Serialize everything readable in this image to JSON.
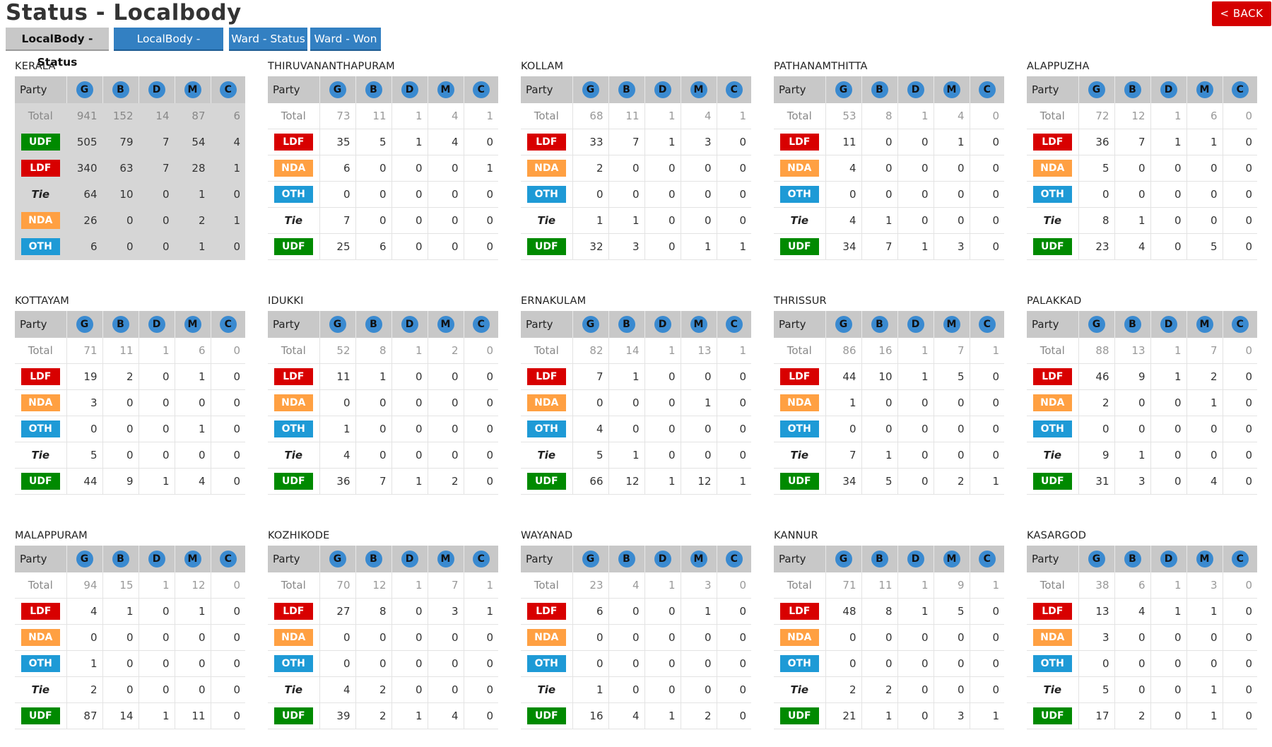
{
  "page_title": "Status - Localbody",
  "back_label": "< BACK",
  "tabs": [
    {
      "label": "LocalBody - Status",
      "active": true
    },
    {
      "label": "LocalBody - Majority",
      "active": false
    },
    {
      "label": "Ward - Status",
      "active": false
    },
    {
      "label": "Ward - Won",
      "active": false
    }
  ],
  "columns": [
    "Party",
    "G",
    "B",
    "D",
    "M",
    "C"
  ],
  "colors": {
    "UDF": "#008a00",
    "LDF": "#d80000",
    "NDA": "#ffa042",
    "OTH": "#1e9ad6",
    "header_circle": "#3a8ad0",
    "tab": "#3380c2",
    "back": "#d50000"
  },
  "districts": [
    {
      "name": "KERALA",
      "rows": [
        {
          "party": "Total",
          "v": [
            941,
            152,
            14,
            87,
            6
          ]
        },
        {
          "party": "UDF",
          "v": [
            505,
            79,
            7,
            54,
            4
          ]
        },
        {
          "party": "LDF",
          "v": [
            340,
            63,
            7,
            28,
            1
          ]
        },
        {
          "party": "Tie",
          "v": [
            64,
            10,
            0,
            1,
            0
          ]
        },
        {
          "party": "NDA",
          "v": [
            26,
            0,
            0,
            2,
            1
          ]
        },
        {
          "party": "OTH",
          "v": [
            6,
            0,
            0,
            1,
            0
          ]
        }
      ]
    },
    {
      "name": "THIRUVANANTHAPURAM",
      "rows": [
        {
          "party": "Total",
          "v": [
            73,
            11,
            1,
            4,
            1
          ]
        },
        {
          "party": "LDF",
          "v": [
            35,
            5,
            1,
            4,
            0
          ]
        },
        {
          "party": "NDA",
          "v": [
            6,
            0,
            0,
            0,
            1
          ]
        },
        {
          "party": "OTH",
          "v": [
            0,
            0,
            0,
            0,
            0
          ]
        },
        {
          "party": "Tie",
          "v": [
            7,
            0,
            0,
            0,
            0
          ]
        },
        {
          "party": "UDF",
          "v": [
            25,
            6,
            0,
            0,
            0
          ]
        }
      ]
    },
    {
      "name": "KOLLAM",
      "rows": [
        {
          "party": "Total",
          "v": [
            68,
            11,
            1,
            4,
            1
          ]
        },
        {
          "party": "LDF",
          "v": [
            33,
            7,
            1,
            3,
            0
          ]
        },
        {
          "party": "NDA",
          "v": [
            2,
            0,
            0,
            0,
            0
          ]
        },
        {
          "party": "OTH",
          "v": [
            0,
            0,
            0,
            0,
            0
          ]
        },
        {
          "party": "Tie",
          "v": [
            1,
            1,
            0,
            0,
            0
          ]
        },
        {
          "party": "UDF",
          "v": [
            32,
            3,
            0,
            1,
            1
          ]
        }
      ]
    },
    {
      "name": "PATHANAMTHITTA",
      "rows": [
        {
          "party": "Total",
          "v": [
            53,
            8,
            1,
            4,
            0
          ]
        },
        {
          "party": "LDF",
          "v": [
            11,
            0,
            0,
            1,
            0
          ]
        },
        {
          "party": "NDA",
          "v": [
            4,
            0,
            0,
            0,
            0
          ]
        },
        {
          "party": "OTH",
          "v": [
            0,
            0,
            0,
            0,
            0
          ]
        },
        {
          "party": "Tie",
          "v": [
            4,
            1,
            0,
            0,
            0
          ]
        },
        {
          "party": "UDF",
          "v": [
            34,
            7,
            1,
            3,
            0
          ]
        }
      ]
    },
    {
      "name": "ALAPPUZHA",
      "rows": [
        {
          "party": "Total",
          "v": [
            72,
            12,
            1,
            6,
            0
          ]
        },
        {
          "party": "LDF",
          "v": [
            36,
            7,
            1,
            1,
            0
          ]
        },
        {
          "party": "NDA",
          "v": [
            5,
            0,
            0,
            0,
            0
          ]
        },
        {
          "party": "OTH",
          "v": [
            0,
            0,
            0,
            0,
            0
          ]
        },
        {
          "party": "Tie",
          "v": [
            8,
            1,
            0,
            0,
            0
          ]
        },
        {
          "party": "UDF",
          "v": [
            23,
            4,
            0,
            5,
            0
          ]
        }
      ]
    },
    {
      "name": "KOTTAYAM",
      "rows": [
        {
          "party": "Total",
          "v": [
            71,
            11,
            1,
            6,
            0
          ]
        },
        {
          "party": "LDF",
          "v": [
            19,
            2,
            0,
            1,
            0
          ]
        },
        {
          "party": "NDA",
          "v": [
            3,
            0,
            0,
            0,
            0
          ]
        },
        {
          "party": "OTH",
          "v": [
            0,
            0,
            0,
            1,
            0
          ]
        },
        {
          "party": "Tie",
          "v": [
            5,
            0,
            0,
            0,
            0
          ]
        },
        {
          "party": "UDF",
          "v": [
            44,
            9,
            1,
            4,
            0
          ]
        }
      ]
    },
    {
      "name": "IDUKKI",
      "rows": [
        {
          "party": "Total",
          "v": [
            52,
            8,
            1,
            2,
            0
          ]
        },
        {
          "party": "LDF",
          "v": [
            11,
            1,
            0,
            0,
            0
          ]
        },
        {
          "party": "NDA",
          "v": [
            0,
            0,
            0,
            0,
            0
          ]
        },
        {
          "party": "OTH",
          "v": [
            1,
            0,
            0,
            0,
            0
          ]
        },
        {
          "party": "Tie",
          "v": [
            4,
            0,
            0,
            0,
            0
          ]
        },
        {
          "party": "UDF",
          "v": [
            36,
            7,
            1,
            2,
            0
          ]
        }
      ]
    },
    {
      "name": "ERNAKULAM",
      "rows": [
        {
          "party": "Total",
          "v": [
            82,
            14,
            1,
            13,
            1
          ]
        },
        {
          "party": "LDF",
          "v": [
            7,
            1,
            0,
            0,
            0
          ]
        },
        {
          "party": "NDA",
          "v": [
            0,
            0,
            0,
            1,
            0
          ]
        },
        {
          "party": "OTH",
          "v": [
            4,
            0,
            0,
            0,
            0
          ]
        },
        {
          "party": "Tie",
          "v": [
            5,
            1,
            0,
            0,
            0
          ]
        },
        {
          "party": "UDF",
          "v": [
            66,
            12,
            1,
            12,
            1
          ]
        }
      ]
    },
    {
      "name": "THRISSUR",
      "rows": [
        {
          "party": "Total",
          "v": [
            86,
            16,
            1,
            7,
            1
          ]
        },
        {
          "party": "LDF",
          "v": [
            44,
            10,
            1,
            5,
            0
          ]
        },
        {
          "party": "NDA",
          "v": [
            1,
            0,
            0,
            0,
            0
          ]
        },
        {
          "party": "OTH",
          "v": [
            0,
            0,
            0,
            0,
            0
          ]
        },
        {
          "party": "Tie",
          "v": [
            7,
            1,
            0,
            0,
            0
          ]
        },
        {
          "party": "UDF",
          "v": [
            34,
            5,
            0,
            2,
            1
          ]
        }
      ]
    },
    {
      "name": "PALAKKAD",
      "rows": [
        {
          "party": "Total",
          "v": [
            88,
            13,
            1,
            7,
            0
          ]
        },
        {
          "party": "LDF",
          "v": [
            46,
            9,
            1,
            2,
            0
          ]
        },
        {
          "party": "NDA",
          "v": [
            2,
            0,
            0,
            1,
            0
          ]
        },
        {
          "party": "OTH",
          "v": [
            0,
            0,
            0,
            0,
            0
          ]
        },
        {
          "party": "Tie",
          "v": [
            9,
            1,
            0,
            0,
            0
          ]
        },
        {
          "party": "UDF",
          "v": [
            31,
            3,
            0,
            4,
            0
          ]
        }
      ]
    },
    {
      "name": "MALAPPURAM",
      "rows": [
        {
          "party": "Total",
          "v": [
            94,
            15,
            1,
            12,
            0
          ]
        },
        {
          "party": "LDF",
          "v": [
            4,
            1,
            0,
            1,
            0
          ]
        },
        {
          "party": "NDA",
          "v": [
            0,
            0,
            0,
            0,
            0
          ]
        },
        {
          "party": "OTH",
          "v": [
            1,
            0,
            0,
            0,
            0
          ]
        },
        {
          "party": "Tie",
          "v": [
            2,
            0,
            0,
            0,
            0
          ]
        },
        {
          "party": "UDF",
          "v": [
            87,
            14,
            1,
            11,
            0
          ]
        }
      ]
    },
    {
      "name": "KOZHIKODE",
      "rows": [
        {
          "party": "Total",
          "v": [
            70,
            12,
            1,
            7,
            1
          ]
        },
        {
          "party": "LDF",
          "v": [
            27,
            8,
            0,
            3,
            1
          ]
        },
        {
          "party": "NDA",
          "v": [
            0,
            0,
            0,
            0,
            0
          ]
        },
        {
          "party": "OTH",
          "v": [
            0,
            0,
            0,
            0,
            0
          ]
        },
        {
          "party": "Tie",
          "v": [
            4,
            2,
            0,
            0,
            0
          ]
        },
        {
          "party": "UDF",
          "v": [
            39,
            2,
            1,
            4,
            0
          ]
        }
      ]
    },
    {
      "name": "WAYANAD",
      "rows": [
        {
          "party": "Total",
          "v": [
            23,
            4,
            1,
            3,
            0
          ]
        },
        {
          "party": "LDF",
          "v": [
            6,
            0,
            0,
            1,
            0
          ]
        },
        {
          "party": "NDA",
          "v": [
            0,
            0,
            0,
            0,
            0
          ]
        },
        {
          "party": "OTH",
          "v": [
            0,
            0,
            0,
            0,
            0
          ]
        },
        {
          "party": "Tie",
          "v": [
            1,
            0,
            0,
            0,
            0
          ]
        },
        {
          "party": "UDF",
          "v": [
            16,
            4,
            1,
            2,
            0
          ]
        }
      ]
    },
    {
      "name": "KANNUR",
      "rows": [
        {
          "party": "Total",
          "v": [
            71,
            11,
            1,
            9,
            1
          ]
        },
        {
          "party": "LDF",
          "v": [
            48,
            8,
            1,
            5,
            0
          ]
        },
        {
          "party": "NDA",
          "v": [
            0,
            0,
            0,
            0,
            0
          ]
        },
        {
          "party": "OTH",
          "v": [
            0,
            0,
            0,
            0,
            0
          ]
        },
        {
          "party": "Tie",
          "v": [
            2,
            2,
            0,
            0,
            0
          ]
        },
        {
          "party": "UDF",
          "v": [
            21,
            1,
            0,
            3,
            1
          ]
        }
      ]
    },
    {
      "name": "KASARGOD",
      "rows": [
        {
          "party": "Total",
          "v": [
            38,
            6,
            1,
            3,
            0
          ]
        },
        {
          "party": "LDF",
          "v": [
            13,
            4,
            1,
            1,
            0
          ]
        },
        {
          "party": "NDA",
          "v": [
            3,
            0,
            0,
            0,
            0
          ]
        },
        {
          "party": "OTH",
          "v": [
            0,
            0,
            0,
            0,
            0
          ]
        },
        {
          "party": "Tie",
          "v": [
            5,
            0,
            0,
            1,
            0
          ]
        },
        {
          "party": "UDF",
          "v": [
            17,
            2,
            0,
            1,
            0
          ]
        }
      ]
    }
  ]
}
